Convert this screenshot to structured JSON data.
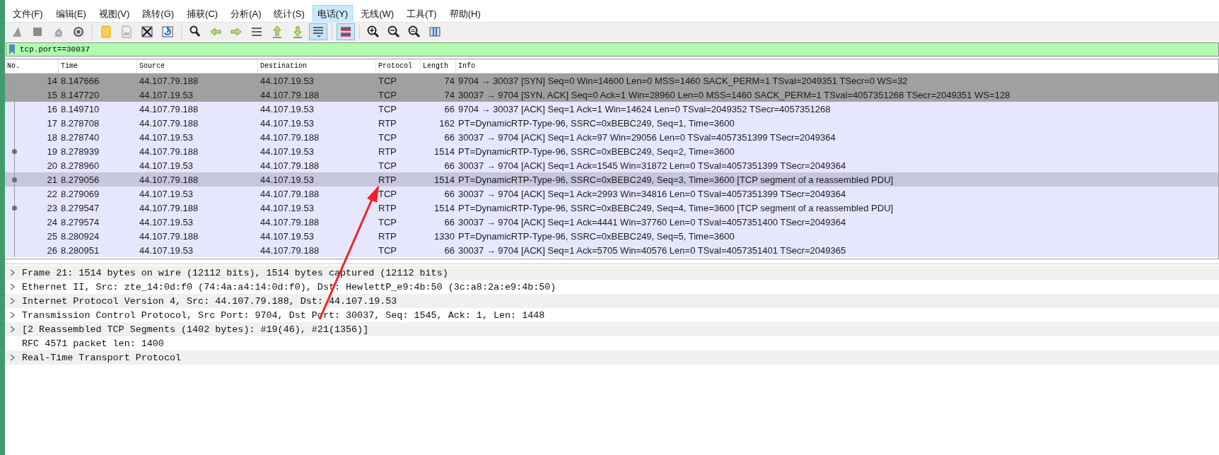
{
  "menu": [
    {
      "label": "文件(F)",
      "selected": false
    },
    {
      "label": "编辑(E)",
      "selected": false
    },
    {
      "label": "视图(V)",
      "selected": false
    },
    {
      "label": "跳转(G)",
      "selected": false
    },
    {
      "label": "捕获(C)",
      "selected": false
    },
    {
      "label": "分析(A)",
      "selected": false
    },
    {
      "label": "统计(S)",
      "selected": false
    },
    {
      "label": "电话(Y)",
      "selected": true
    },
    {
      "label": "无线(W)",
      "selected": false
    },
    {
      "label": "工具(T)",
      "selected": false
    },
    {
      "label": "帮助(H)",
      "selected": false
    }
  ],
  "toolbar_groups": [
    {
      "tools": [
        {
          "kind": "fin",
          "on": false
        },
        {
          "kind": "stop",
          "on": false
        },
        {
          "kind": "restart",
          "on": false
        },
        {
          "kind": "gear",
          "on": false
        }
      ]
    },
    {
      "tools": [
        {
          "kind": "folder",
          "on": false
        },
        {
          "kind": "file",
          "on": false
        },
        {
          "kind": "close-file",
          "on": false
        },
        {
          "kind": "reload",
          "on": false
        }
      ]
    },
    {
      "tools": [
        {
          "kind": "search",
          "on": false
        },
        {
          "kind": "arrow-left",
          "on": false
        },
        {
          "kind": "arrow-right",
          "on": false
        },
        {
          "kind": "goto",
          "on": false
        },
        {
          "kind": "arrow-up",
          "on": false
        },
        {
          "kind": "arrow-down",
          "on": false
        },
        {
          "kind": "autoscroll",
          "on": true
        }
      ]
    },
    {
      "tools": [
        {
          "kind": "colorize",
          "on": true
        }
      ]
    },
    {
      "tools": [
        {
          "kind": "zoom-in",
          "on": false
        },
        {
          "kind": "zoom-out",
          "on": false
        },
        {
          "kind": "zoom-reset",
          "on": false
        },
        {
          "kind": "columns",
          "on": false
        }
      ]
    }
  ],
  "filter": {
    "value": "tcp.port==30037"
  },
  "table": {
    "columns": [
      "No.",
      "Time",
      "Source",
      "Destination",
      "Protocol",
      "Length",
      "Info"
    ],
    "rows": [
      {
        "no": "14",
        "time": "8.147666",
        "source": "44.107.79.188",
        "destination": "44.107.19.53",
        "protocol": "TCP",
        "length": "74",
        "info": "9704 → 30037 [SYN] Seq=0 Win=14600 Len=0 MSS=1460 SACK_PERM=1 TSval=2049351 TSecr=0 WS=32",
        "kind": "handshake",
        "selected": false,
        "related": false
      },
      {
        "no": "15",
        "time": "8.147720",
        "source": "44.107.19.53",
        "destination": "44.107.79.188",
        "protocol": "TCP",
        "length": "74",
        "info": "30037 → 9704 [SYN, ACK] Seq=0 Ack=1 Win=28960 Len=0 MSS=1460 SACK_PERM=1 TSval=4057351268 TSecr=2049351 WS=128",
        "kind": "handshake",
        "selected": false,
        "related": false
      },
      {
        "no": "16",
        "time": "8.149710",
        "source": "44.107.79.188",
        "destination": "44.107.19.53",
        "protocol": "TCP",
        "length": "66",
        "info": "9704 → 30037 [ACK] Seq=1 Ack=1 Win=14624 Len=0 TSval=2049352 TSecr=4057351268",
        "kind": "normal",
        "selected": false,
        "related": false
      },
      {
        "no": "17",
        "time": "8.278708",
        "source": "44.107.79.188",
        "destination": "44.107.19.53",
        "protocol": "RTP",
        "length": "162",
        "info": "PT=DynamicRTP-Type-96, SSRC=0xBEBC249, Seq=1, Time=3600",
        "kind": "normal",
        "selected": false,
        "related": false
      },
      {
        "no": "18",
        "time": "8.278740",
        "source": "44.107.19.53",
        "destination": "44.107.79.188",
        "protocol": "TCP",
        "length": "66",
        "info": "30037 → 9704 [ACK] Seq=1 Ack=97 Win=29056 Len=0 TSval=4057351399 TSecr=2049364",
        "kind": "normal",
        "selected": false,
        "related": false
      },
      {
        "no": "19",
        "time": "8.278939",
        "source": "44.107.79.188",
        "destination": "44.107.19.53",
        "protocol": "RTP",
        "length": "1514",
        "info": "PT=DynamicRTP-Type-96, SSRC=0xBEBC249, Seq=2, Time=3600",
        "kind": "normal",
        "selected": false,
        "related": true
      },
      {
        "no": "20",
        "time": "8.278960",
        "source": "44.107.19.53",
        "destination": "44.107.79.188",
        "protocol": "TCP",
        "length": "66",
        "info": "30037 → 9704 [ACK] Seq=1 Ack=1545 Win=31872 Len=0 TSval=4057351399 TSecr=2049364",
        "kind": "normal",
        "selected": false,
        "related": false
      },
      {
        "no": "21",
        "time": "8.279056",
        "source": "44.107.79.188",
        "destination": "44.107.19.53",
        "protocol": "RTP",
        "length": "1514",
        "info": "PT=DynamicRTP-Type-96, SSRC=0xBEBC249, Seq=3, Time=3600 [TCP segment of a reassembled PDU]",
        "kind": "normal",
        "selected": true,
        "related": true
      },
      {
        "no": "22",
        "time": "8.279069",
        "source": "44.107.19.53",
        "destination": "44.107.79.188",
        "protocol": "TCP",
        "length": "66",
        "info": "30037 → 9704 [ACK] Seq=1 Ack=2993 Win=34816 Len=0 TSval=4057351399 TSecr=2049364",
        "kind": "normal",
        "selected": false,
        "related": false
      },
      {
        "no": "23",
        "time": "8.279547",
        "source": "44.107.79.188",
        "destination": "44.107.19.53",
        "protocol": "RTP",
        "length": "1514",
        "info": "PT=DynamicRTP-Type-96, SSRC=0xBEBC249, Seq=4, Time=3600 [TCP segment of a reassembled PDU]",
        "kind": "normal",
        "selected": false,
        "related": true
      },
      {
        "no": "24",
        "time": "8.279574",
        "source": "44.107.19.53",
        "destination": "44.107.79.188",
        "protocol": "TCP",
        "length": "66",
        "info": "30037 → 9704 [ACK] Seq=1 Ack=4441 Win=37760 Len=0 TSval=4057351400 TSecr=2049364",
        "kind": "normal",
        "selected": false,
        "related": false
      },
      {
        "no": "25",
        "time": "8.280924",
        "source": "44.107.79.188",
        "destination": "44.107.19.53",
        "protocol": "RTP",
        "length": "1330",
        "info": "PT=DynamicRTP-Type-96, SSRC=0xBEBC249, Seq=5, Time=3600",
        "kind": "normal",
        "selected": false,
        "related": false
      },
      {
        "no": "26",
        "time": "8.280951",
        "source": "44.107.19.53",
        "destination": "44.107.79.188",
        "protocol": "TCP",
        "length": "66",
        "info": "30037 → 9704 [ACK] Seq=1 Ack=5705 Win=40576 Len=0 TSval=4057351401 TSecr=2049365",
        "kind": "normal",
        "selected": false,
        "related": false
      }
    ]
  },
  "details": [
    {
      "text": "Frame 21: 1514 bytes on wire (12112 bits), 1514 bytes captured (12112 bits)",
      "expandable": true
    },
    {
      "text": "Ethernet II, Src: zte_14:0d:f0 (74:4a:a4:14:0d:f0), Dst: HewlettP_e9:4b:50 (3c:a8:2a:e9:4b:50)",
      "expandable": true
    },
    {
      "text": "Internet Protocol Version 4, Src: 44.107.79.188, Dst: 44.107.19.53",
      "expandable": true
    },
    {
      "text": "Transmission Control Protocol, Src Port: 9704, Dst Port: 30037, Seq: 1545, Ack: 1, Len: 1448",
      "expandable": true
    },
    {
      "text": "[2 Reassembled TCP Segments (1402 bytes): #19(46), #21(1356)]",
      "expandable": true
    },
    {
      "text": "RFC 4571 packet len: 1400",
      "expandable": false
    },
    {
      "text": "Real-Time Transport Protocol",
      "expandable": true
    }
  ]
}
